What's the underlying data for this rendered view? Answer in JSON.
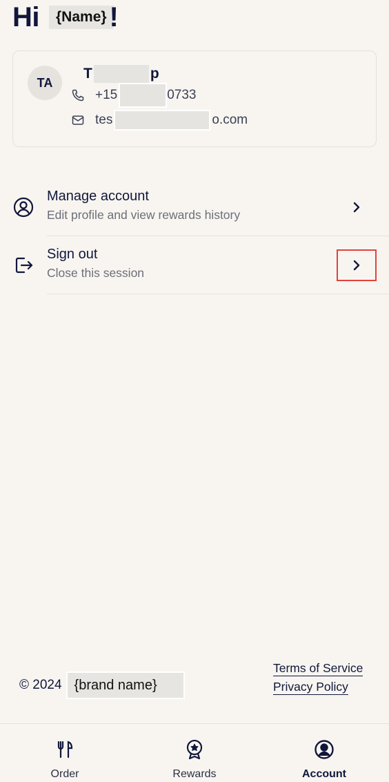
{
  "greeting": {
    "prefix": "Hi ",
    "name_placeholder": "{Name}",
    "suffix": "!"
  },
  "profile": {
    "initials": "TA",
    "name_start": "T",
    "name_end": "p",
    "phone_start": "+15",
    "phone_end": "0733",
    "email_start": "tes",
    "email_end": "o.com"
  },
  "menu": [
    {
      "title": "Manage account",
      "subtitle": "Edit profile and view rewards history",
      "icon": "user-circle-icon"
    },
    {
      "title": "Sign out",
      "subtitle": "Close this session",
      "icon": "sign-out-icon"
    }
  ],
  "footer": {
    "copyright": "© 2024",
    "brand_placeholder": "{brand name}",
    "terms": "Terms of Service",
    "privacy": "Privacy Policy"
  },
  "nav": [
    {
      "label": "Order",
      "icon": "fork-knife-icon",
      "active": false
    },
    {
      "label": "Rewards",
      "icon": "rewards-badge-icon",
      "active": false
    },
    {
      "label": "Account",
      "icon": "account-icon",
      "active": true
    }
  ],
  "colors": {
    "background": "#f8f5f1",
    "primary_text": "#10173a",
    "highlight": "#e1423a"
  }
}
